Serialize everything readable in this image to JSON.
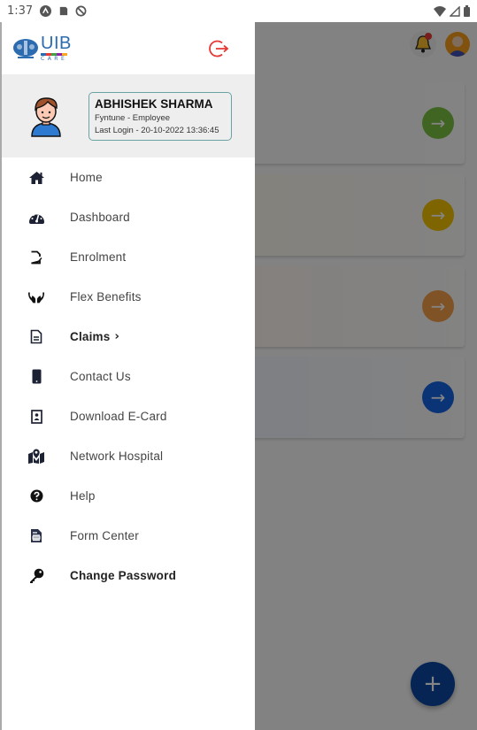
{
  "status_bar": {
    "time": "1:37",
    "left_icons": [
      "assistant-icon",
      "sd-card-icon",
      "do-not-disturb-icon"
    ],
    "right_icons": [
      "wifi-icon",
      "signal-icon",
      "battery-icon"
    ]
  },
  "drawer": {
    "logo": {
      "title": "UIB",
      "subtitle": "CARE"
    },
    "logout_icon": "logout-icon",
    "profile": {
      "name": "ABHISHEK SHARMA",
      "role": "Fyntune - Employee",
      "last_login": "Last Login - 20-10-2022 13:36:45"
    },
    "menu": [
      {
        "label": "Home",
        "icon": "home-icon",
        "bold": false
      },
      {
        "label": "Dashboard",
        "icon": "dashboard-icon",
        "bold": false
      },
      {
        "label": "Enrolment",
        "icon": "enrolment-icon",
        "bold": false
      },
      {
        "label": "Flex Benefits",
        "icon": "hands-icon",
        "bold": false
      },
      {
        "label": "Claims",
        "icon": "document-icon",
        "bold": true,
        "chevron": "›"
      },
      {
        "label": "Contact Us",
        "icon": "mobile-icon",
        "bold": false
      },
      {
        "label": "Download E-Card",
        "icon": "id-card-icon",
        "bold": false
      },
      {
        "label": "Network Hospital",
        "icon": "map-marker-icon",
        "bold": false
      },
      {
        "label": "Help",
        "icon": "help-icon",
        "bold": false
      },
      {
        "label": "Form Center",
        "icon": "form-icon",
        "bold": false
      },
      {
        "label": "Change Password",
        "icon": "key-icon",
        "bold": true
      }
    ]
  },
  "background": {
    "cards": [
      {
        "accent": "#7cc242"
      },
      {
        "accent": "#f2c200"
      },
      {
        "accent": "#f5a04a"
      },
      {
        "accent": "#1565e0"
      }
    ],
    "fab_label": "+",
    "fab_color": "#0d47a1"
  },
  "colors": {
    "logout": "#e53935",
    "brand": "#2b6cb0",
    "icon": "#1c2233"
  }
}
